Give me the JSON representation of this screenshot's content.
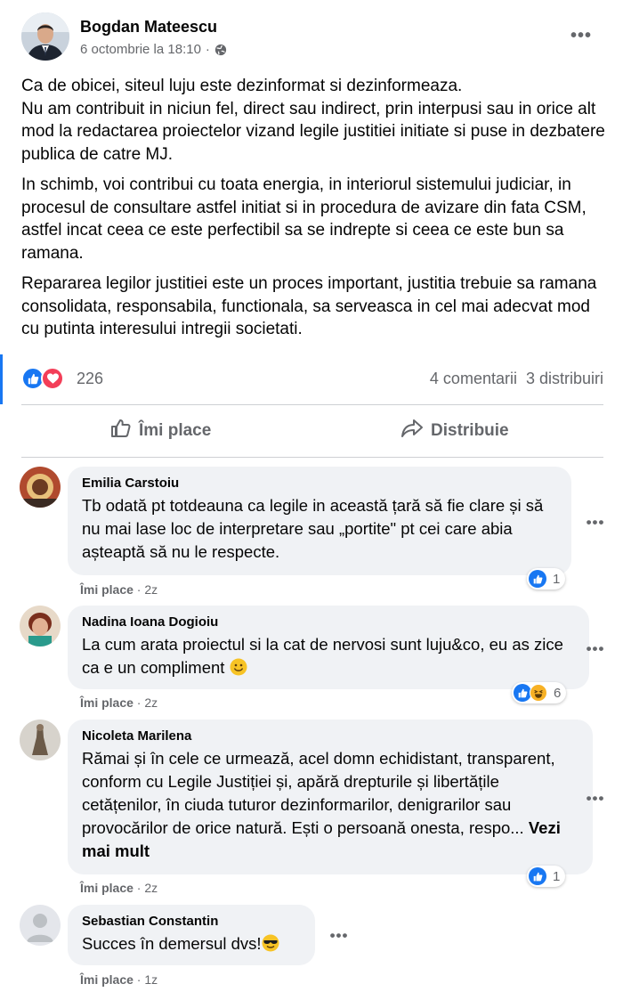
{
  "post": {
    "author": "Bogdan Mateescu",
    "date": "6 octombrie la 18:10",
    "separator": "·",
    "paragraphs": [
      "Ca de obicei, siteul luju este dezinformat si dezinformeaza.\nNu am contribuit in niciun fel, direct sau indirect, prin interpusi sau in orice alt mod la redactarea proiectelor vizand legile justitiei initiate si puse in dezbatere publica de catre MJ.",
      "In schimb, voi contribui cu toata energia, in interiorul sistemului judiciar, in procesul de consultare astfel initiat si in procedura de avizare din fata CSM, astfel incat ceea ce este perfectibil sa se indrepte si ceea ce este bun sa ramana.",
      "Repararea legilor justitiei este un proces important, justitia trebuie sa ramana consolidata, responsabila, functionala,  sa serveasca in cel mai adecvat mod cu putinta interesului intregii societati."
    ],
    "reaction_count": "226",
    "comments_count": "4 comentarii",
    "shares_count": "3 distribuiri",
    "actions": {
      "like": "Îmi place",
      "share": "Distribuie"
    }
  },
  "comments": [
    {
      "name": "Emilia Carstoiu",
      "text": "Tb odată pt totdeauna ca legile in această țară să fie clare și să nu mai lase loc de interpretare sau „portite\" pt cei care abia așteaptă să nu le respecte.",
      "like_label": "Îmi place",
      "time": "2z",
      "reaction_count": "1",
      "reactions": [
        "like-icon"
      ]
    },
    {
      "name": "Nadina Ioana Dogioiu",
      "text": "La cum arata proiectul si la cat de nervosi sunt luju&co, eu as zice ca e un compliment",
      "like_label": "Îmi place",
      "time": "2z",
      "reaction_count": "6",
      "reactions": [
        "like-icon",
        "haha-icon"
      ]
    },
    {
      "name": "Nicoleta Marilena",
      "text": "Rămai și în cele ce urmează, acel domn echidistant, transparent, conform cu Legile Justiției și, apără drepturile și libertățile cetățenilor, în ciuda tuturor dezinformarilor, denigrarilor sau provocărilor de orice natură. Ești o persoană onesta, respo...",
      "see_more": "Vezi mai mult",
      "like_label": "Îmi place",
      "time": "2z",
      "reaction_count": "1",
      "reactions": [
        "like-icon"
      ]
    },
    {
      "name": "Sebastian Constantin",
      "text": "Succes în demersul dvs!",
      "like_label": "Îmi place",
      "time": "1z",
      "reactions": []
    }
  ],
  "colors": {
    "accent": "#1877f2",
    "love": "#f33e58",
    "bubble": "#f0f2f5",
    "muted": "#65676b"
  }
}
